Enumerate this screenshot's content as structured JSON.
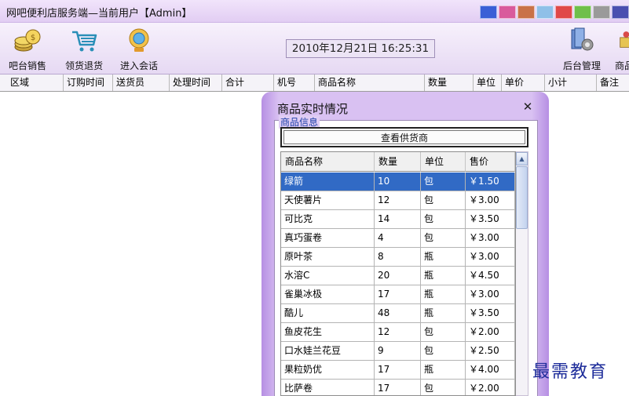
{
  "window": {
    "title": "网吧便利店服务端—当前用户【Admin】",
    "theme_swatches": [
      "#3a5fd6",
      "#d95a9c",
      "#c97248",
      "#8fc0e8",
      "#e04848",
      "#6fbf4a",
      "#9a9a9a",
      "#4a4fb0"
    ]
  },
  "toolbar": {
    "left_buttons": [
      {
        "label": "吧台销售",
        "icon": "coins-icon"
      },
      {
        "label": "领货退货",
        "icon": "shopping-cart-icon"
      },
      {
        "label": "进入会话",
        "icon": "chat-globe-icon"
      }
    ],
    "datetime": "2010年12月21日 16:25:31",
    "right_buttons": [
      {
        "label": "后台管理",
        "icon": "admin-tools-icon"
      },
      {
        "label": "商品",
        "icon": "product-icon"
      }
    ]
  },
  "order_grid": {
    "columns": [
      "区域",
      "订购时间",
      "送货员",
      "处理时间",
      "合计",
      "机号",
      "商品名称",
      "数量",
      "单位",
      "单价",
      "小计",
      "备注"
    ]
  },
  "modal": {
    "title": "商品实时情况",
    "close_icon": "close-icon",
    "group_label": "商品信息",
    "supplier_button": "查看供货商",
    "table": {
      "columns": [
        "商品名称",
        "数量",
        "单位",
        "售价"
      ],
      "selected_index": 0,
      "rows": [
        {
          "name": "绿箭",
          "qty": "10",
          "unit": "包",
          "price": "￥1.50"
        },
        {
          "name": "天使薯片",
          "qty": "12",
          "unit": "包",
          "price": "￥3.00"
        },
        {
          "name": "可比克",
          "qty": "14",
          "unit": "包",
          "price": "￥3.50"
        },
        {
          "name": "真巧蛋卷",
          "qty": "4",
          "unit": "包",
          "price": "￥3.00"
        },
        {
          "name": "原叶茶",
          "qty": "8",
          "unit": "瓶",
          "price": "￥3.00"
        },
        {
          "name": "水溶C",
          "qty": "20",
          "unit": "瓶",
          "price": "￥4.50"
        },
        {
          "name": "雀巢冰极",
          "qty": "17",
          "unit": "瓶",
          "price": "￥3.00"
        },
        {
          "name": "酷儿",
          "qty": "48",
          "unit": "瓶",
          "price": "￥3.50"
        },
        {
          "name": "鱼皮花生",
          "qty": "12",
          "unit": "包",
          "price": "￥2.00"
        },
        {
          "name": "口水娃兰花豆",
          "qty": "9",
          "unit": "包",
          "price": "￥2.50"
        },
        {
          "name": "果粒奶优",
          "qty": "17",
          "unit": "瓶",
          "price": "￥4.00"
        },
        {
          "name": "比萨卷",
          "qty": "17",
          "unit": "包",
          "price": "￥2.00"
        }
      ]
    }
  },
  "watermark": "最需教育"
}
